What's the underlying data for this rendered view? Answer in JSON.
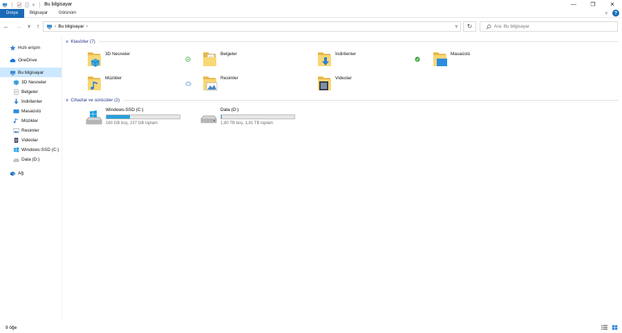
{
  "window": {
    "title": "Bu bilgisayar",
    "minimize": "—",
    "maximize": "❐",
    "close": "✕"
  },
  "ribbon": {
    "tabs": [
      "Dosya",
      "Bilgisayar",
      "Görünüm"
    ],
    "help": "?"
  },
  "address": {
    "path": "Bu bilgisayar",
    "search_placeholder": "Ara: Bu bilgisayar"
  },
  "sidebar": {
    "items": [
      {
        "label": "Hızlı erişim",
        "icon": "star-icon"
      },
      {
        "label": "OneDrive",
        "icon": "cloud-icon"
      },
      {
        "label": "Bu bilgisayar",
        "icon": "computer-icon",
        "selected": true
      },
      {
        "label": "3D Nesneler",
        "icon": "3d-objects-icon"
      },
      {
        "label": "Belgeler",
        "icon": "documents-icon"
      },
      {
        "label": "İndirilenler",
        "icon": "downloads-icon"
      },
      {
        "label": "Masaüstü",
        "icon": "desktop-icon"
      },
      {
        "label": "Müzikler",
        "icon": "music-icon"
      },
      {
        "label": "Resimler",
        "icon": "pictures-icon"
      },
      {
        "label": "Videolar",
        "icon": "videos-icon"
      },
      {
        "label": "Windows-SSD (C:)",
        "icon": "drive-c-icon"
      },
      {
        "label": "Data (D:)",
        "icon": "drive-d-icon"
      },
      {
        "label": "Ağ",
        "icon": "network-icon"
      }
    ]
  },
  "groups": {
    "folders_header": "Klasörler (7)",
    "devices_header": "Cihazlar ve sürücüler (2)"
  },
  "folders": [
    {
      "name": "3D Nesneler",
      "status": "synced",
      "badge": "3d-objects-icon"
    },
    {
      "name": "Belgeler",
      "status": "none",
      "badge": "documents-icon"
    },
    {
      "name": "İndirilenler",
      "status": "available-locally",
      "badge": "downloads-icon"
    },
    {
      "name": "Masaüstü",
      "status": "none",
      "badge": "desktop-icon"
    },
    {
      "name": "Müzikler",
      "status": "cloud",
      "badge": "music-icon"
    },
    {
      "name": "Resimler",
      "status": "none",
      "badge": "pictures-icon"
    },
    {
      "name": "Videolar",
      "status": "none",
      "badge": "videos-icon"
    }
  ],
  "drives": [
    {
      "name": "Windows-SSD (C:)",
      "info": "160 GB boş, 237 GB toplam",
      "used_fraction": 0.325
    },
    {
      "name": "Data (D:)",
      "info": "1,80 TB boş, 1,81 TB toplam",
      "used_fraction": 0.006
    }
  ],
  "statusbar": {
    "count": "9 öğe"
  },
  "colors": {
    "accent": "#1a6bb6",
    "selection": "#cce8ff",
    "drive_fill": "#26a0da",
    "group_header": "#1e3287",
    "folder_yellow": "#f8d775"
  }
}
